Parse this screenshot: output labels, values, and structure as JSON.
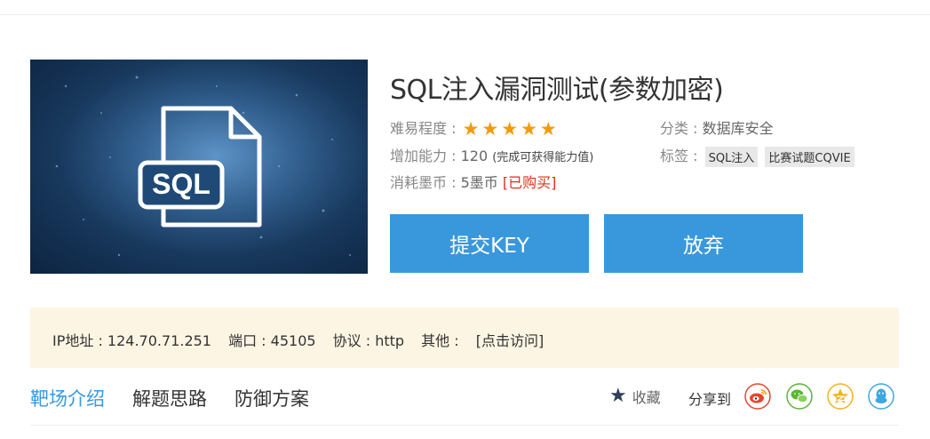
{
  "title": "SQL注入漏洞测试(参数加密)",
  "cover": {
    "label": "SQL",
    "icon": "sql-file-icon"
  },
  "meta": {
    "difficulty_label": "难易程度 :",
    "difficulty_stars": 5,
    "ability_label": "增加能力 :",
    "ability_value": "120",
    "ability_note": "(完成可获得能力值)",
    "cost_label": "消耗墨币 :",
    "cost_value": "5墨币",
    "cost_status": "[已购买]",
    "category_label": "分类 :",
    "category_value": "数据库安全",
    "tags_label": "标签 :",
    "tags": [
      "SQL注入",
      "比赛试题CQVIE"
    ]
  },
  "buttons": {
    "submit": "提交KEY",
    "giveup": "放弃"
  },
  "ipbar": {
    "ip": "IP地址 : 124.70.71.251",
    "port": "端口 : 45105",
    "protocol": "协议 : http",
    "other_label": "其他 :",
    "visit_link": "[点击访问]"
  },
  "tabs": [
    "靶场介绍",
    "解题思路",
    "防御方案"
  ],
  "collect_label": "收藏",
  "share_label": "分享到",
  "share_icons": [
    "weibo-icon",
    "wechat-icon",
    "qzone-icon",
    "qq-icon"
  ],
  "colors": {
    "accent": "#3998dc",
    "star": "#f29a0b",
    "ipbar_bg": "#fdf5e3",
    "status_red": "#e0301e"
  }
}
